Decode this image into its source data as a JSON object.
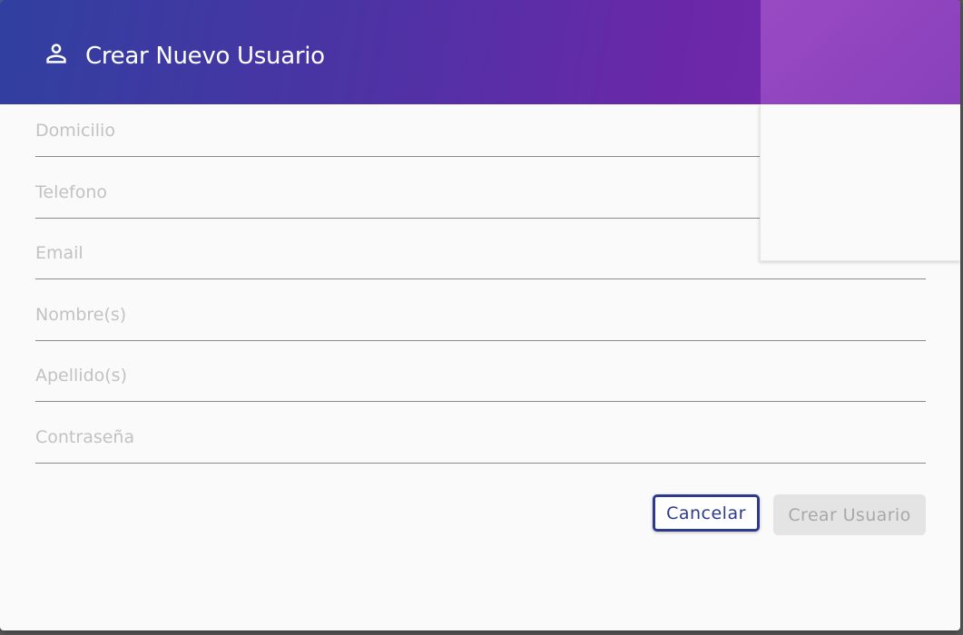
{
  "dialog": {
    "title": "Crear Nuevo Usuario",
    "icon": "person-icon"
  },
  "form": {
    "fields": [
      {
        "label": "Domicilio",
        "value": ""
      },
      {
        "label": "Telefono",
        "value": ""
      },
      {
        "label": "Email",
        "value": ""
      },
      {
        "label": "Nombre(s)",
        "value": ""
      },
      {
        "label": "Apellido(s)",
        "value": ""
      },
      {
        "label": "Contraseña",
        "value": ""
      }
    ]
  },
  "actions": {
    "cancel_label": "Cancelar",
    "create_label": "Crear Usuario"
  },
  "colors": {
    "header_gradient_start": "#3040a0",
    "header_gradient_end": "#7a2aae",
    "primary": "#2d3a8c",
    "disabled_bg": "#e4e4e4",
    "disabled_text": "#a8a8a8"
  }
}
